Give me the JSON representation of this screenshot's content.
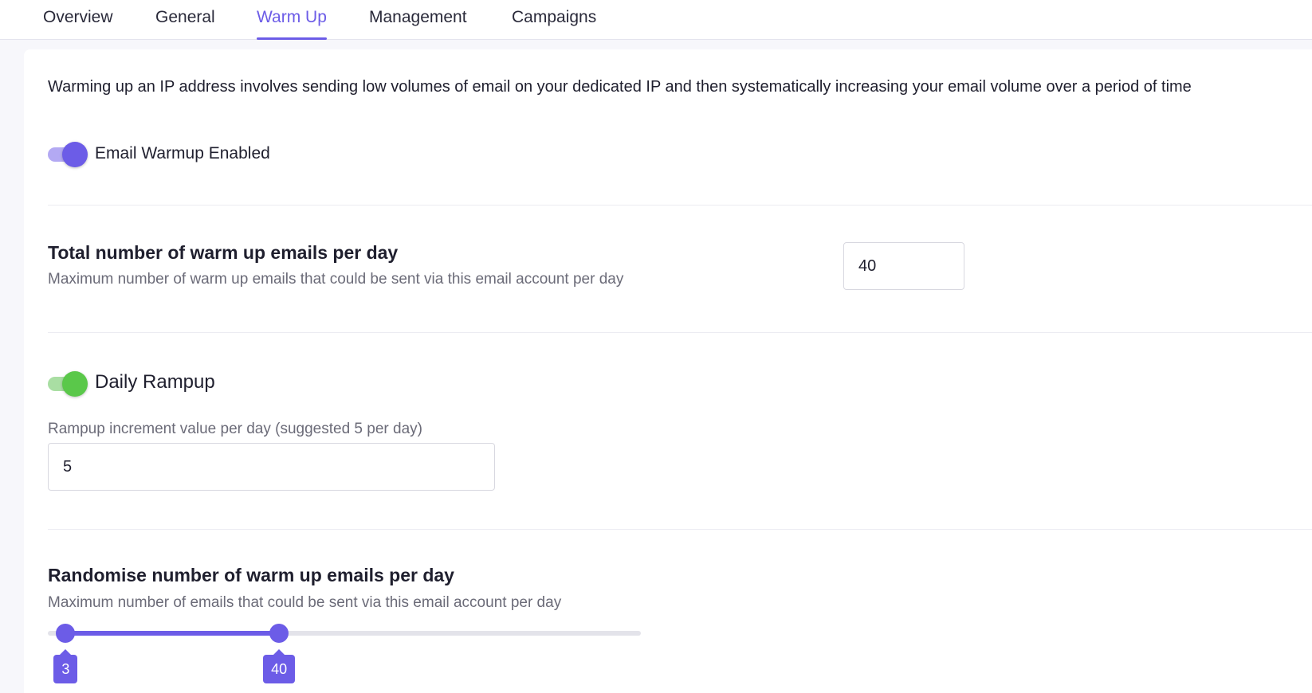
{
  "tabs": [
    {
      "label": "Overview"
    },
    {
      "label": "General"
    },
    {
      "label": "Warm Up"
    },
    {
      "label": "Management"
    },
    {
      "label": "Campaigns"
    }
  ],
  "active_tab": "Warm Up",
  "intro_text": "Warming up an IP address involves sending low volumes of email on your dedicated IP and then systematically increasing your email volume over a period of time",
  "warmup_toggle": {
    "label": "Email Warmup Enabled",
    "enabled": true,
    "color": "#6c5ce7"
  },
  "total_emails": {
    "title": "Total number of warm up emails per day",
    "description": "Maximum number of warm up emails that could be sent via this email account per day",
    "value": "40"
  },
  "daily_rampup": {
    "label": "Daily Rampup",
    "enabled": true,
    "color": "#5ac84a",
    "increment_label": "Rampup increment value per day (suggested 5 per day)",
    "increment_value": "5"
  },
  "randomise": {
    "title": "Randomise number of warm up emails per day",
    "description": "Maximum number of emails that could be sent via this email account per day",
    "min_value": "3",
    "max_value": "40",
    "range_fraction_low": 0.03,
    "range_fraction_high": 0.39
  },
  "colors": {
    "accent": "#6c5ce7",
    "success": "#5ac84a"
  }
}
